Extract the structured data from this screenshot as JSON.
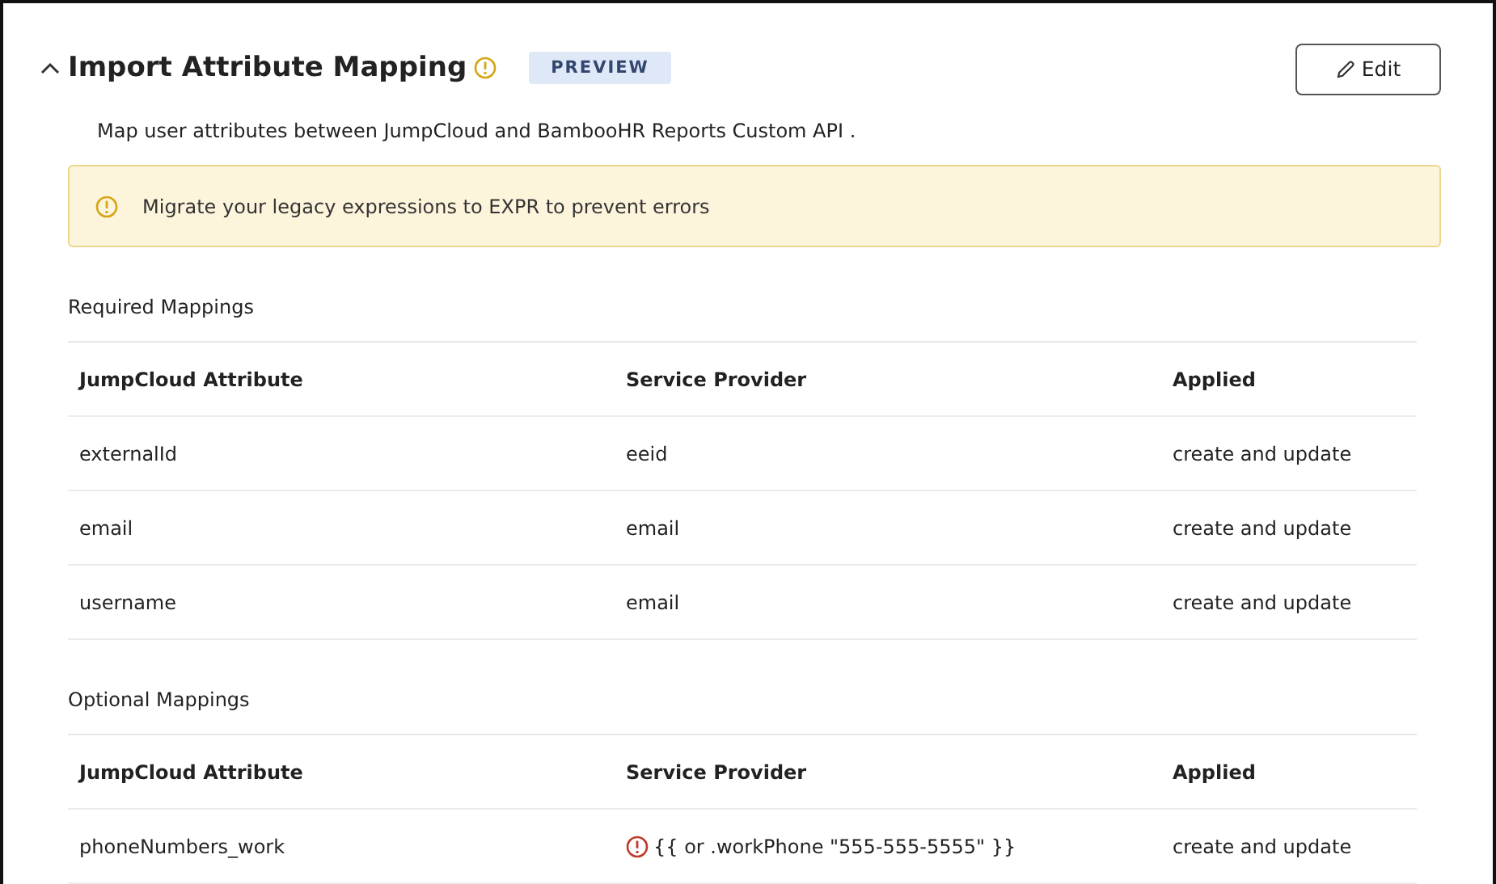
{
  "header": {
    "title": "Import Attribute Mapping",
    "expanded": true,
    "badge": "PREVIEW",
    "edit_button": "Edit"
  },
  "description": "Map user attributes between JumpCloud and BambooHR Reports Custom API .",
  "alert": {
    "text": "Migrate your legacy expressions to EXPR to prevent errors"
  },
  "sections": [
    {
      "title": "Required Mappings",
      "columns": [
        "JumpCloud Attribute",
        "Service Provider",
        "Applied"
      ],
      "rows": [
        {
          "attribute": "externalId",
          "provider": "eeid",
          "applied": "create and update",
          "error": false
        },
        {
          "attribute": "email",
          "provider": "email",
          "applied": "create and update",
          "error": false
        },
        {
          "attribute": "username",
          "provider": "email",
          "applied": "create and update",
          "error": false
        }
      ]
    },
    {
      "title": "Optional Mappings",
      "columns": [
        "JumpCloud Attribute",
        "Service Provider",
        "Applied"
      ],
      "rows": [
        {
          "attribute": "phoneNumbers_work",
          "provider": "{{ or .workPhone \"555-555-5555\" }}",
          "applied": "create and update",
          "error": true
        }
      ]
    }
  ]
}
